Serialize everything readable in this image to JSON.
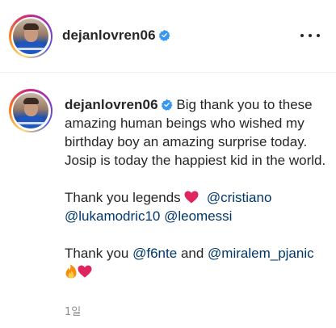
{
  "header": {
    "username": "dejanlovren06",
    "more_icon": "more-horizontal-icon"
  },
  "caption": {
    "username": "dejanlovren06",
    "body": "Big thank you to these amazing human beings who wished my birthday boy an amazing surprise today. Josip is today the happiest kid in the world.",
    "line2_prefix": "Thank you legends",
    "line2_mentions": [
      "@cristiano",
      "@lukamodric10",
      "@leomessi"
    ],
    "line3_prefix": "Thank you",
    "line3_mention1": "@f6nte",
    "line3_and": "and",
    "line3_mention2": "@miralem_pjanic"
  },
  "timestamp": "1일",
  "colors": {
    "mention": "#00376b",
    "verified": "#3897f0",
    "heart": "#e0245e",
    "muted": "#8e8e8e"
  },
  "icons": [
    "verified-badge-icon",
    "red-heart-emoji",
    "fire-emoji",
    "more-horizontal-icon"
  ]
}
